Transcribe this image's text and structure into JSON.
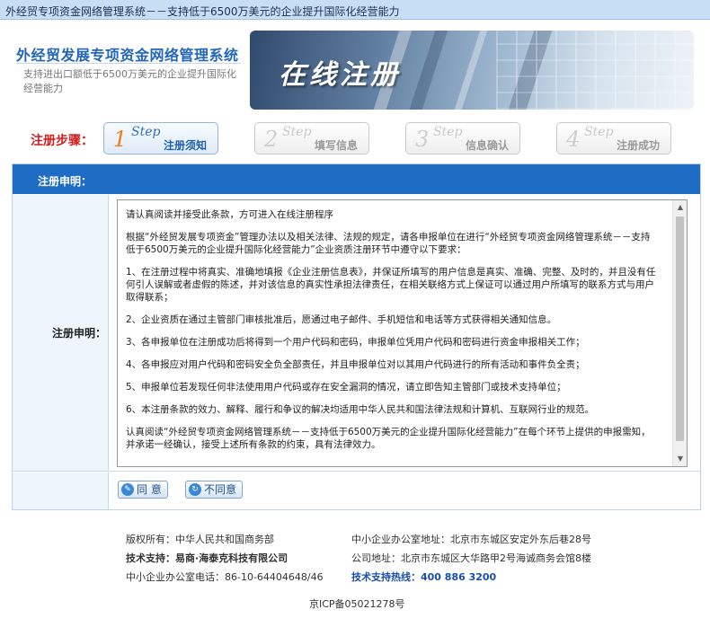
{
  "topbar": {
    "title": "外经贸专项资金网络管理系统－－支持低于6500万美元的企业提升国际化经营能力"
  },
  "header": {
    "site_title": "外经贸发展专项资金网络管理系统",
    "site_subtitle": "支持进出口额低于6500万美元的企业提升国际化经营能力",
    "banner_text": "在线注册"
  },
  "steps": {
    "label": "注册步骤：",
    "items": [
      {
        "num": "1",
        "word": "Step",
        "name": "注册须知",
        "active": true
      },
      {
        "num": "2",
        "word": "Step",
        "name": "填写信息",
        "active": false
      },
      {
        "num": "3",
        "word": "Step",
        "name": "信息确认",
        "active": false
      },
      {
        "num": "4",
        "word": "Step",
        "name": "注册成功",
        "active": false
      }
    ]
  },
  "panel": {
    "header": "注册申明：",
    "row_label": "注册申明：",
    "agreement": [
      "请认真阅读并接受此条款，方可进入在线注册程序",
      "根据“外经贸发展专项资金”管理办法以及相关法律、法规的规定，请各申报单位在进行“外经贸专项资金网络管理系统－－支持低于6500万美元的企业提升国际化经营能力”企业资质注册环节中遵守以下要求：",
      "1、在注册过程中将真实、准确地填报《企业注册信息表》，并保证所填写的用户信息是真实、准确、完整、及时的，并且没有任何引人误解或者虚假的陈述，并对该信息的真实性承担法律责任，在相关联络方式上保证可以通过用户所填写的联系方式与用户取得联系；",
      "2、企业资质在通过主管部门审核批准后，愿通过电子邮件、手机短信和电话等方式获得相关通知信息。",
      "3、各申报单位在注册成功后将得到一个用户代码和密码，申报单位凭用户代码和密码进行资金申报相关工作；",
      "4、各申报应对用户代码和密码安全负全部责任，并且申报单位对以其用户代码进行的所有活动和事件负全责；",
      "5、申报单位若发现任何非法使用用户代码或存在安全漏洞的情况，请立即告知主管部门或技术支持单位；",
      "6、本注册条款的效力、解释、履行和争议的解决均适用中华人民共和国法律法规和计算机、互联网行业的规范。",
      "认真阅读“外经贸专项资金网络管理系统－－支持低于6500万美元的企业提升国际化经营能力”在每个环节上提供的申报需知，并承诺一经确认，接受上述所有条款的约束，具有法律效力。"
    ],
    "agree_label": "同 意",
    "disagree_label": "不同意"
  },
  "footer": {
    "copyright": "版权所有：中华人民共和国商务部",
    "office_address": "中小企业办公室地址：北京市东城区安定外东后巷28号",
    "tech_support": "技术支持：易商·海泰克科技有限公司",
    "company_address": "公司地址：北京市东城区大华路甲2号海诚商务会馆8楼",
    "office_phone": "中小企业办公室电话：86-10-64404648/46",
    "support_hotline": "技术支持热线：400 886 3200",
    "icp": "京ICP备05021278号"
  }
}
